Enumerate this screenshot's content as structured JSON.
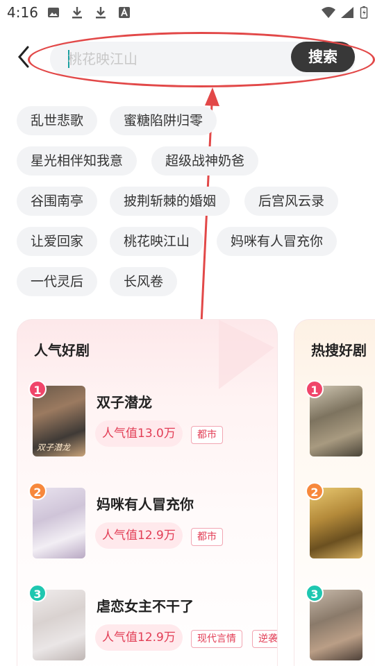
{
  "status": {
    "time": "4:16"
  },
  "search": {
    "placeholder": "桃花映江山",
    "button": "搜索"
  },
  "tags": [
    "乱世悲歌",
    "蜜糖陷阱归零",
    "星光相伴知我意",
    "超级战神奶爸",
    "谷围南亭",
    "披荆斩棘的婚姻",
    "后宫风云录",
    "让爱回家",
    "桃花映江山",
    "妈咪有人冒充你",
    "一代灵后",
    "长风卷"
  ],
  "popular": {
    "title": "人气好剧",
    "items": [
      {
        "rank": "1",
        "title": "双子潜龙",
        "popularity": "人气值13.0万",
        "genres": [
          "都市"
        ],
        "cover_text": "双子潜龙"
      },
      {
        "rank": "2",
        "title": "妈咪有人冒充你",
        "popularity": "人气值12.9万",
        "genres": [
          "都市"
        ],
        "cover_text": ""
      },
      {
        "rank": "3",
        "title": "虐恋女主不干了",
        "popularity": "人气值12.9万",
        "genres": [
          "现代言情",
          "逆袭"
        ],
        "cover_text": ""
      }
    ]
  },
  "hot": {
    "title": "热搜好剧",
    "items": [
      {
        "rank": "1"
      },
      {
        "rank": "2"
      },
      {
        "rank": "3"
      }
    ]
  },
  "colors": {
    "rank1": "#f0456a",
    "rank2": "#f7883c",
    "rank3": "#1fc7b0",
    "annotation": "#e24848"
  }
}
